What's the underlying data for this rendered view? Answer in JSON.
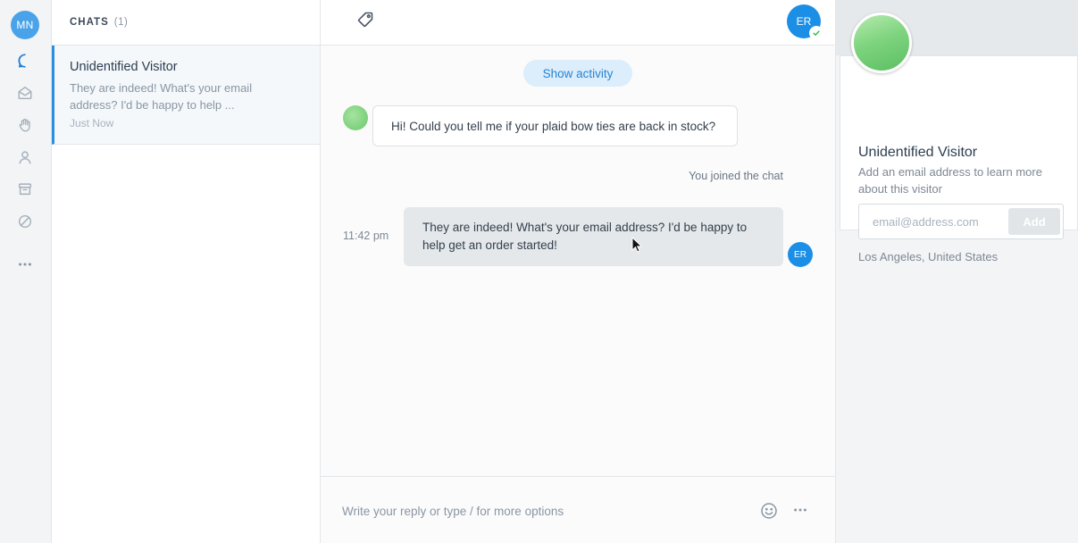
{
  "rail": {
    "user_initials": "MN",
    "items": [
      "chat-icon",
      "inbox-icon",
      "hand-icon",
      "person-icon",
      "archive-icon",
      "blocked-icon",
      "more-icon"
    ]
  },
  "chats": {
    "header": "CHATS",
    "count": "(1)",
    "conversations": [
      {
        "name": "Unidentified Visitor",
        "preview": "They are indeed! What's your email address? I'd be happy to help ...",
        "time": "Just Now"
      }
    ]
  },
  "conversation": {
    "agent_initials": "ER",
    "show_activity_label": "Show activity",
    "messages": [
      {
        "from": "visitor",
        "text": "Hi! Could you tell me if your plaid bow ties are back in stock?"
      },
      {
        "from": "system",
        "text": "You joined the chat"
      },
      {
        "from": "agent",
        "time": "11:42 pm",
        "text": "They are indeed! What's your email address? I'd be happy to help get an order started!",
        "initials": "ER"
      }
    ],
    "compose_placeholder": "Write your reply or type / for more options"
  },
  "visitor": {
    "name": "Unidentified Visitor",
    "hint": "Add an email address to learn more about this visitor",
    "email_placeholder": "email@address.com",
    "add_label": "Add",
    "location": "Los Angeles, United States"
  },
  "colors": {
    "accent": "#1b8fe6",
    "active_row_border": "#2b8fe0",
    "status_online": "#3cba54"
  }
}
